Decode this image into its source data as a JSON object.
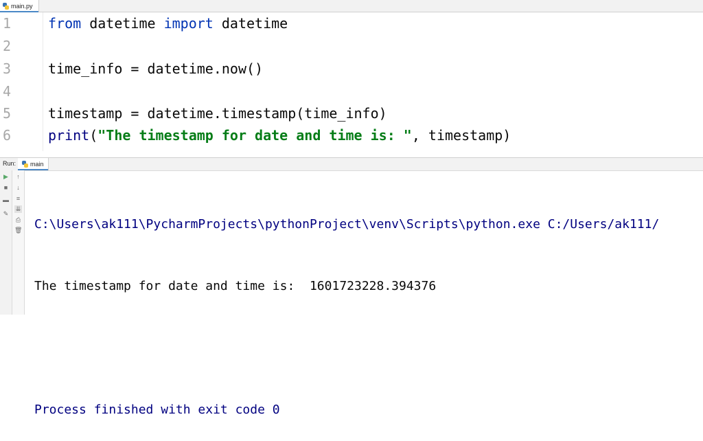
{
  "editor": {
    "tab_label": "main.py",
    "lines": [
      {
        "num": "1",
        "t1": "from",
        "t2": " datetime ",
        "t3": "import",
        "t4": " datetime"
      },
      {
        "num": "2"
      },
      {
        "num": "3",
        "text": "time_info = datetime.now()"
      },
      {
        "num": "4"
      },
      {
        "num": "5",
        "text": "timestamp = datetime.timestamp(time_info)"
      },
      {
        "num": "6",
        "fn": "print",
        "p1": "(",
        "str": "\"The timestamp for date and time is: \"",
        "rest": ", timestamp)"
      }
    ]
  },
  "run": {
    "label": "Run:",
    "tab_label": "main"
  },
  "console": {
    "path_line": "C:\\Users\\ak111\\PycharmProjects\\pythonProject\\venv\\Scripts\\python.exe C:/Users/ak111/",
    "output_line": "The timestamp for date and time is:  1601723228.394376",
    "exit_line": "Process finished with exit code 0"
  },
  "colors": {
    "keyword": "#0033b3",
    "string": "#067d17",
    "console_system": "#000080"
  }
}
